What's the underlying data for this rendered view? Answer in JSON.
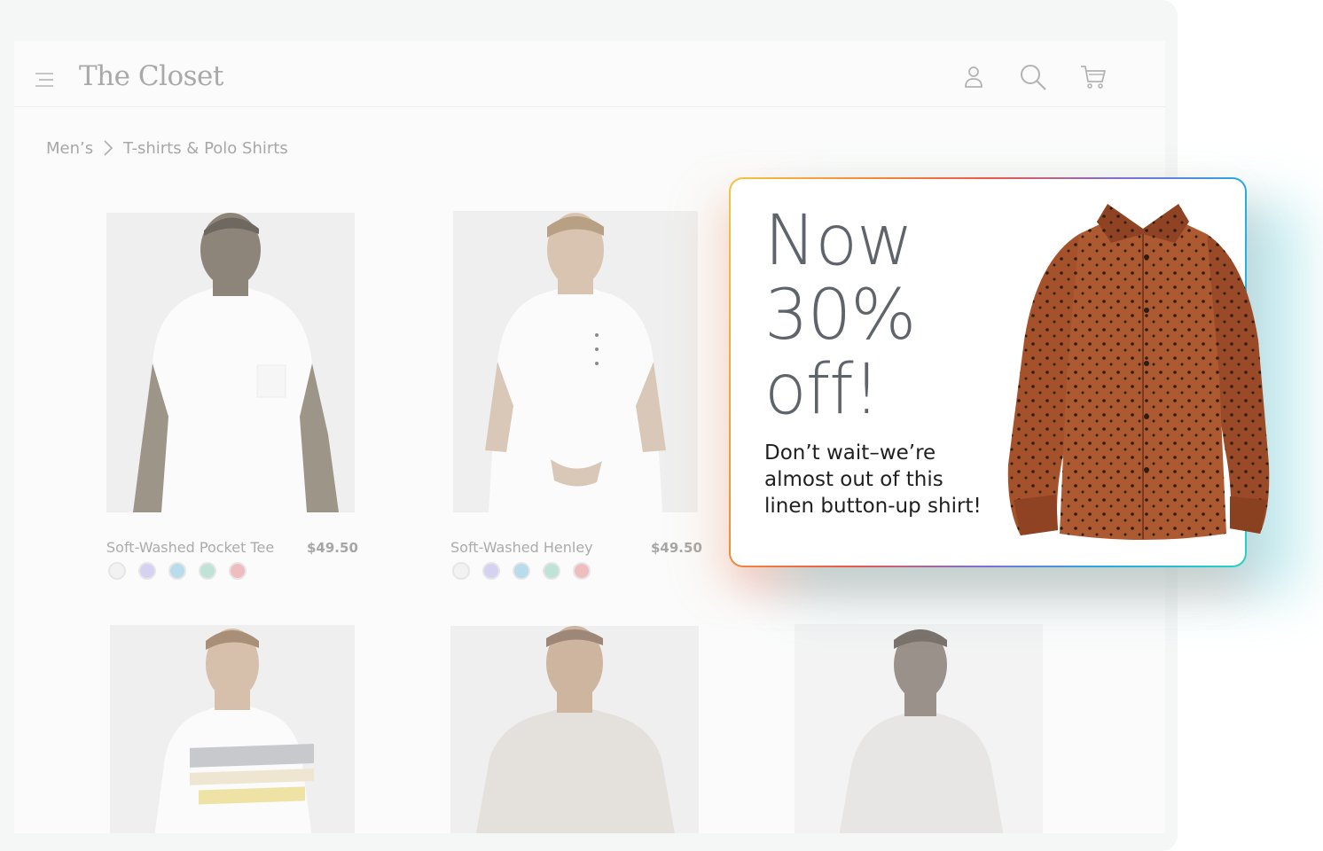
{
  "header": {
    "brand": "The Closet",
    "icons": [
      "menu-icon",
      "user-icon",
      "search-icon",
      "cart-icon"
    ]
  },
  "breadcrumb": {
    "items": [
      "Men’s",
      "T-shirts & Polo Shirts"
    ]
  },
  "products": [
    {
      "name": "Soft-Washed Pocket Tee",
      "price": "$49.50",
      "swatches": [
        "#f2f2f2",
        "#d5d1f0",
        "#b8dcec",
        "#bfe3d7",
        "#efbdbd"
      ]
    },
    {
      "name": "Soft-Washed Henley",
      "price": "$49.50",
      "swatches": [
        "#f2f2f2",
        "#d5d1f0",
        "#b8dcec",
        "#bfe3d7",
        "#efbdbd"
      ]
    }
  ],
  "promo": {
    "headline": [
      "Now",
      "30%",
      "off!"
    ],
    "subtext": [
      "Don’t wait–we’re",
      "almost out of this",
      "linen button-up shirt!"
    ],
    "image": "polka-dot-rust-shirt",
    "border_gradient": [
      "#f4c542",
      "#e9584a",
      "#2aa8e0",
      "#27d1c5"
    ]
  },
  "colors": {
    "shirt": "#a5512a",
    "text_muted": "#a9a9a9"
  }
}
